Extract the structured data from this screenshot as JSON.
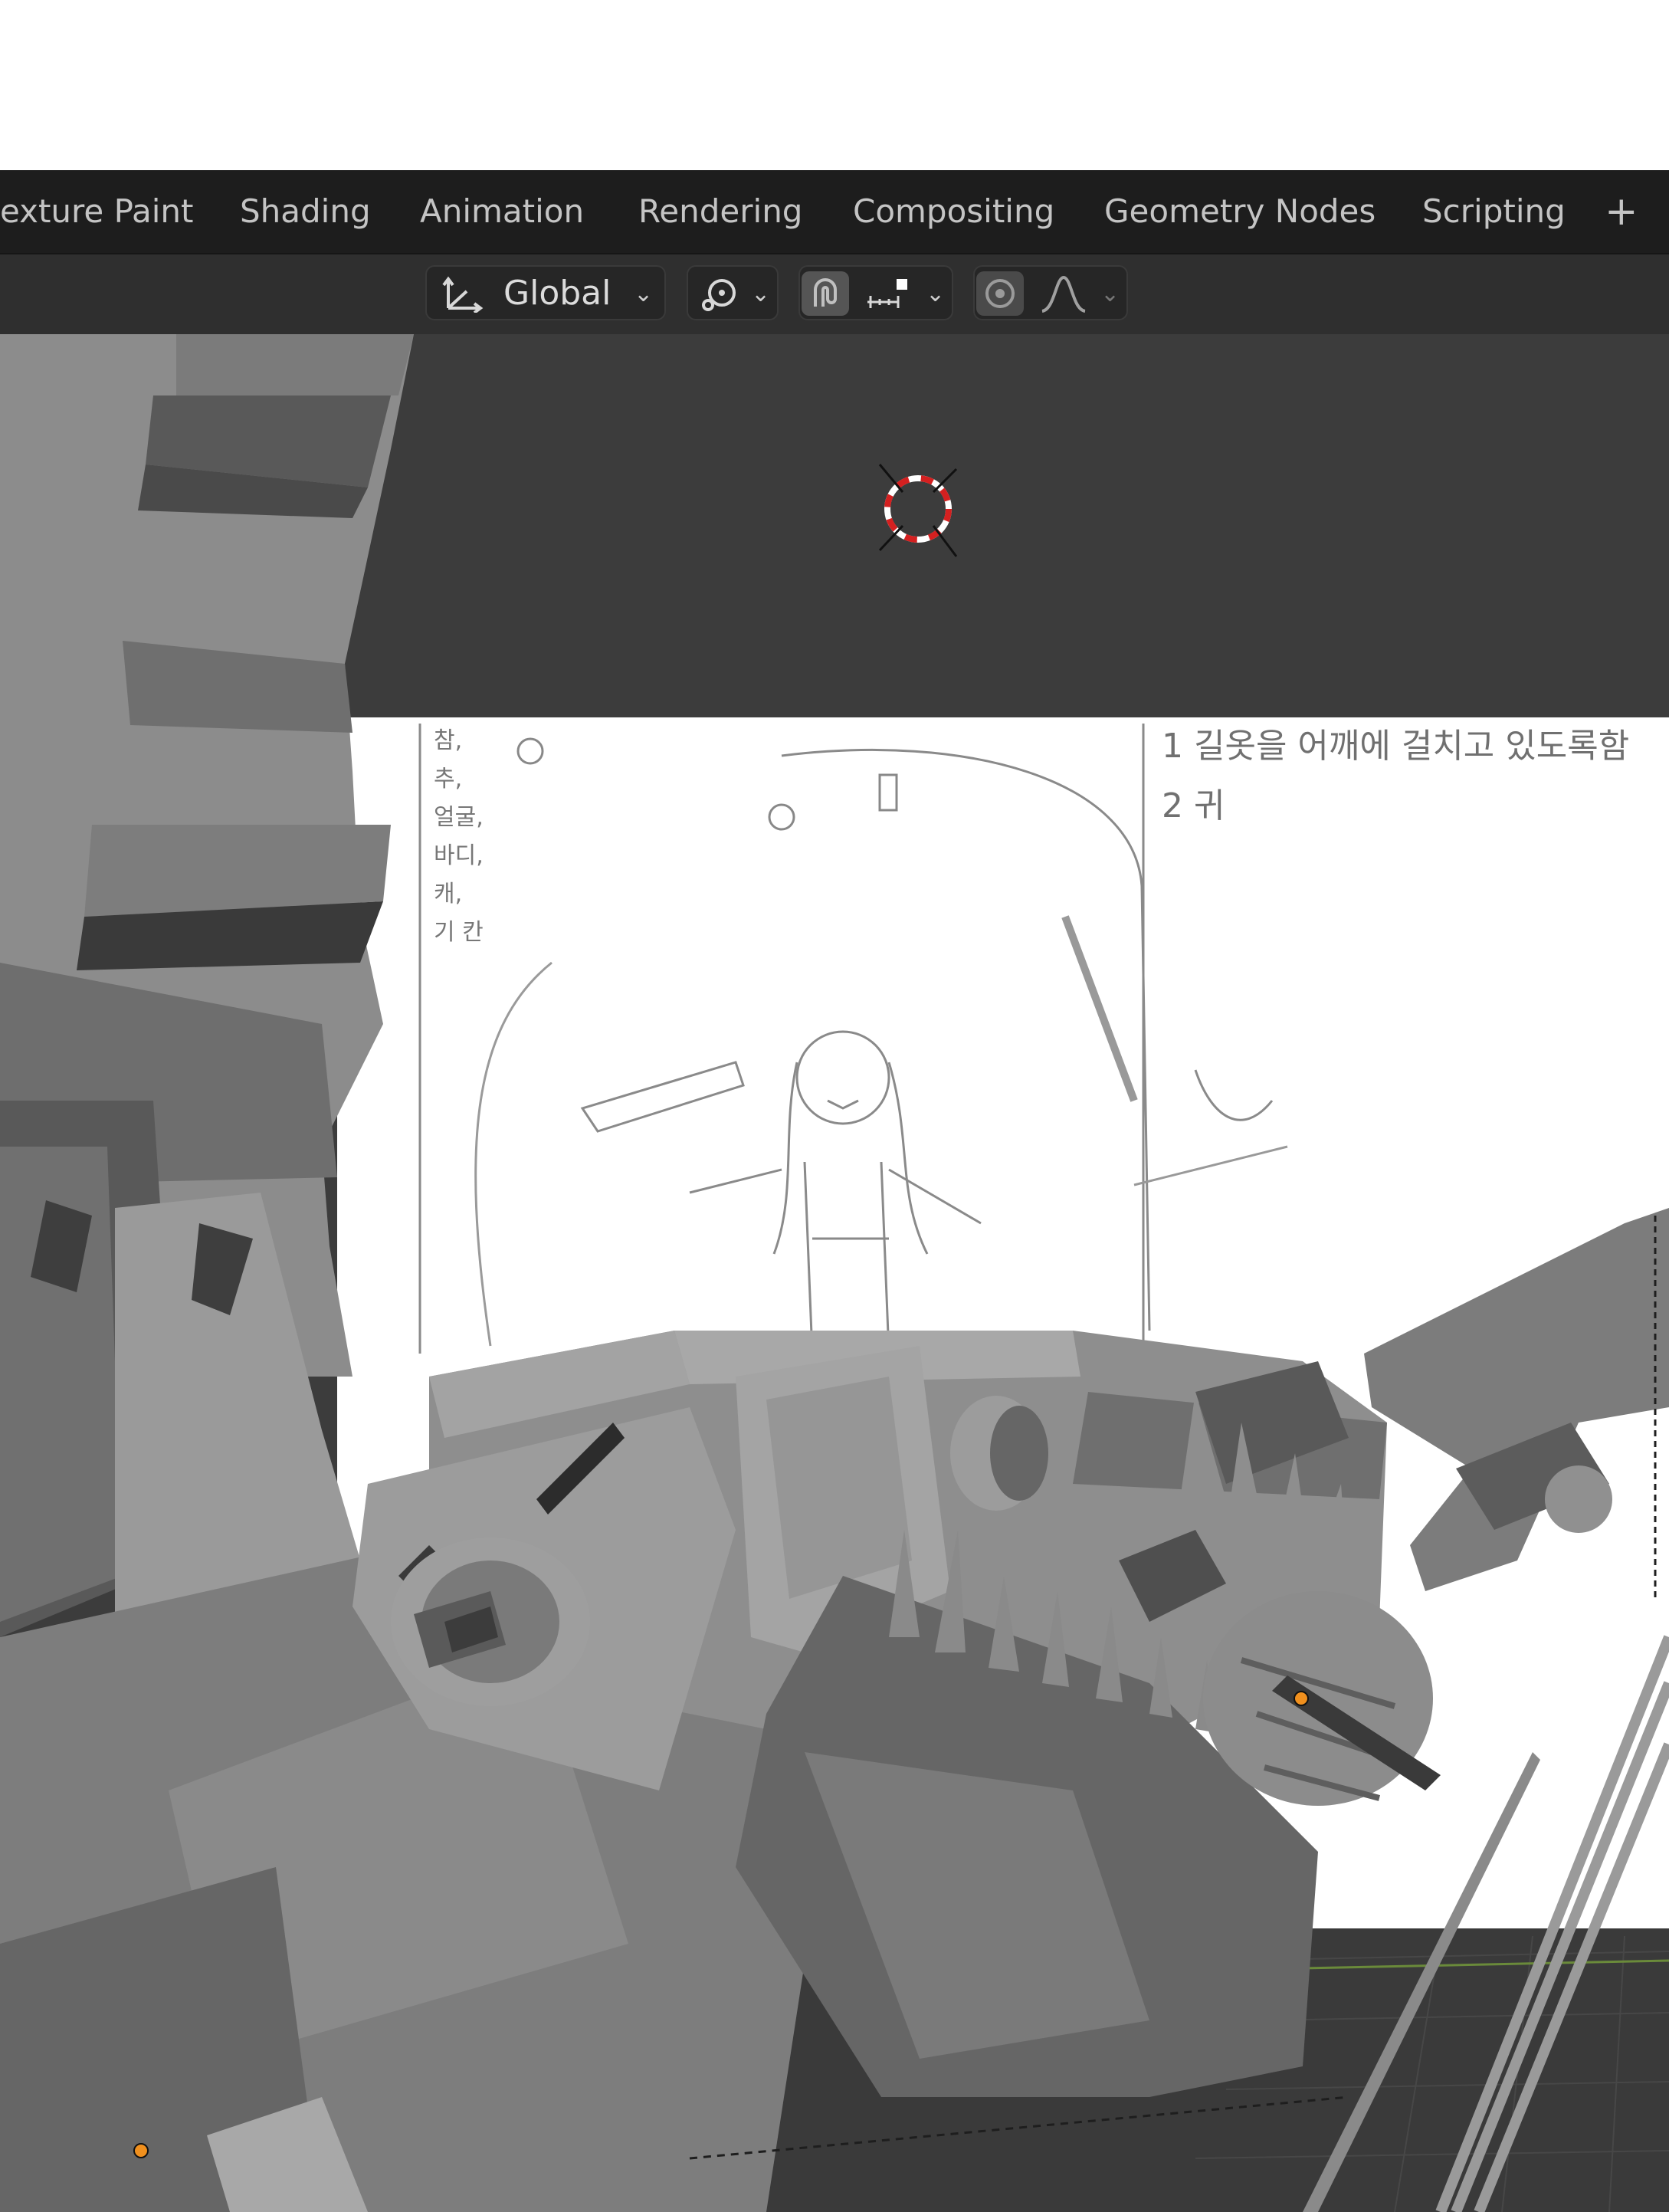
{
  "workspace_tabs": [
    {
      "label": "exture Paint"
    },
    {
      "label": "Shading"
    },
    {
      "label": "Animation"
    },
    {
      "label": "Rendering"
    },
    {
      "label": "Compositing"
    },
    {
      "label": "Geometry Nodes"
    },
    {
      "label": "Scripting"
    }
  ],
  "add_workspace_label": "+",
  "header": {
    "transform_orientation": "Global"
  },
  "reference_sketch": {
    "note_line_1": "1 길옷을 어깨에 걸치고 있도록함",
    "note_line_2": "2 귀",
    "side_notes": [
      "참,",
      "추,",
      "얼굴,",
      "바디,",
      "캐,",
      "기 칸"
    ]
  },
  "colors": {
    "tab_bar": "#1d1d1d",
    "header": "#2f2f2f",
    "viewport": "#3c3c3c",
    "model": "#8c8c8c",
    "cursor_red": "#d42020",
    "origin_dot": "#f0901e"
  }
}
